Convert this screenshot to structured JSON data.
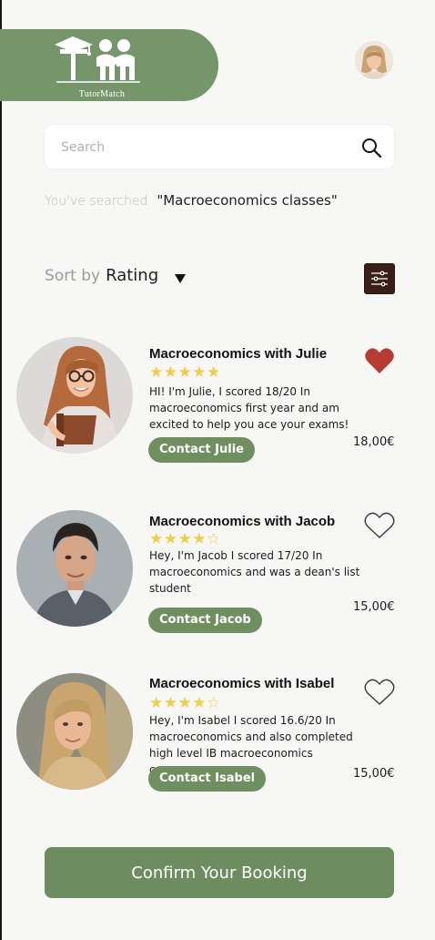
{
  "header": {
    "logo_text": "TutorMatch",
    "accent_color": "#75966a"
  },
  "search": {
    "placeholder": "Search",
    "value": ""
  },
  "searched": {
    "prefix": "You've searched",
    "query": "\"Macroeconomics classes\""
  },
  "sort": {
    "label": "Sort by",
    "value": "Rating"
  },
  "tutors": [
    {
      "title": "Macroeconomics with Julie",
      "rating": 5,
      "stars": "★★★★★",
      "description": "HI! I'm Julie, I scored 18/20 In macroeconomics first year and am excited to help you ace your exams!",
      "contact_label": "Contact Julie",
      "price": "18,00€",
      "favorited": true
    },
    {
      "title": "Macroeconomics with Jacob",
      "rating": 4,
      "stars": "★★★★☆",
      "description": "Hey, I'm Jacob I scored 17/20 In macroeconomics and was a dean's list student",
      "contact_label": "Contact Jacob",
      "price": "15,00€",
      "favorited": false
    },
    {
      "title": "Macroeconomics with Isabel",
      "rating": 4,
      "stars": "★★★★☆",
      "description": "Hey, I'm Isabel I scored 16.6/20 In macroeconomics and also completed high level IB macroeconomics courses.",
      "contact_label": "Contact Isabel",
      "price": "15,00€",
      "favorited": false
    }
  ],
  "confirm_label": "Confirm Your Booking",
  "colors": {
    "button_green": "#6f8f61",
    "heart_red": "#b63c32",
    "star_yellow": "#f2cd47",
    "filter_bg": "#3a1f18"
  },
  "icons": {
    "search": "search-icon",
    "sort": "caret-down-icon",
    "filter": "sliders-icon",
    "favorite": "heart-icon"
  }
}
